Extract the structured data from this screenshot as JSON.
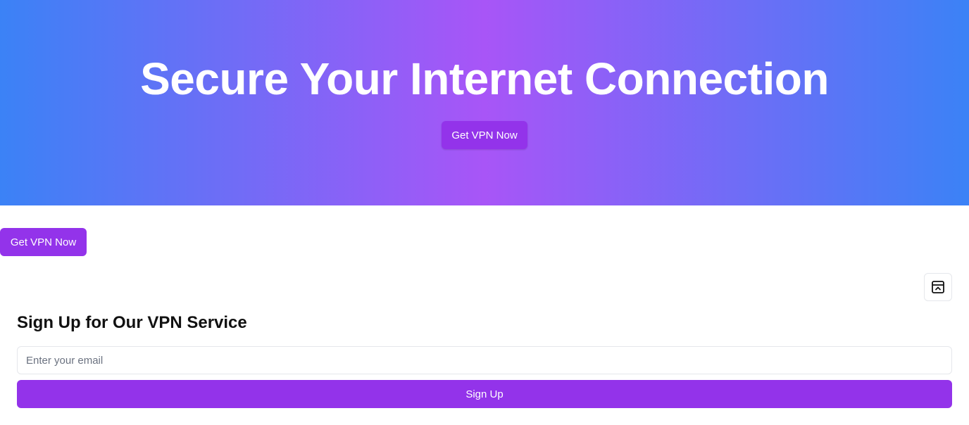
{
  "hero": {
    "title": "Secure Your Internet Connection",
    "cta_label": "Get VPN Now",
    "gradient_colors": [
      "#3b82f6",
      "#a855f7",
      "#3b82f6"
    ]
  },
  "secondary_cta": {
    "label": "Get VPN Now"
  },
  "corner_button": {
    "icon": "collapse-panel-icon"
  },
  "signup": {
    "title": "Sign Up for Our VPN Service",
    "email_placeholder": "Enter your email",
    "email_value": "",
    "submit_label": "Sign Up"
  },
  "colors": {
    "accent": "#9333ea",
    "border": "#e5e7eb",
    "text": "#111111"
  }
}
